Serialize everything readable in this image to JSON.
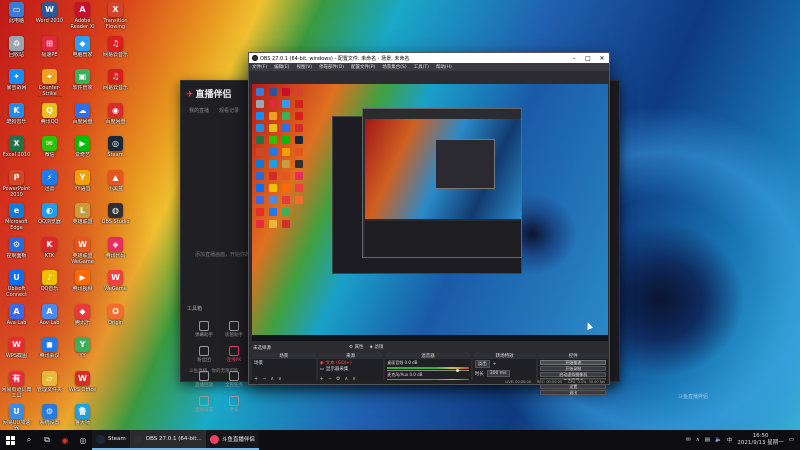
{
  "desktop": {
    "icons": [
      {
        "label": "此电脑",
        "icon": "computer-icon",
        "color": "#3a7bd5",
        "glyph": "▭"
      },
      {
        "label": "Word 2010",
        "icon": "word-icon",
        "color": "#2b579a",
        "glyph": "W"
      },
      {
        "label": "Adobe Reader XI",
        "icon": "adobe-reader-icon",
        "color": "#c8102e",
        "glyph": "A"
      },
      {
        "label": "Transition Flowing",
        "icon": "transition-icon",
        "color": "#d4412c",
        "glyph": "X"
      },
      {
        "label": "回收站",
        "icon": "recycle-bin-icon",
        "color": "#9aa6b2",
        "glyph": "♻"
      },
      {
        "label": "极速PE",
        "icon": "app-icon",
        "color": "#e0283c",
        "glyph": "⊞"
      },
      {
        "label": "电脑管家",
        "icon": "pc-manager-icon",
        "color": "#2a9df4",
        "glyph": "◆"
      },
      {
        "label": "网易云音乐",
        "icon": "music-icon",
        "color": "#d81e1e",
        "glyph": "♫"
      },
      {
        "label": "暴雪战网",
        "icon": "battlenet-icon",
        "color": "#148eff",
        "glyph": "✦"
      },
      {
        "label": "Counter-Strike Global Off",
        "icon": "csgo-icon",
        "color": "#f0a020",
        "glyph": "⌖"
      },
      {
        "label": "软件管家",
        "icon": "software-manager-icon",
        "color": "#3ab05a",
        "glyph": "▣"
      },
      {
        "label": "网易云音乐",
        "icon": "music-icon",
        "color": "#d81e1e",
        "glyph": "♫"
      },
      {
        "label": "酷狗音乐",
        "icon": "kugou-icon",
        "color": "#1e8ee8",
        "glyph": "K"
      },
      {
        "label": "腾讯QQ",
        "icon": "qq-icon",
        "color": "#e8c01e",
        "glyph": "Q"
      },
      {
        "label": "百度网盘",
        "icon": "baidu-netdisk-icon",
        "color": "#2f6fe8",
        "glyph": "☁"
      },
      {
        "label": "百度网盘",
        "icon": "app-icon",
        "color": "#d82c2c",
        "glyph": "◉"
      },
      {
        "label": "Excel 2010",
        "icon": "excel-icon",
        "color": "#217346",
        "glyph": "X"
      },
      {
        "label": "微信",
        "icon": "wechat-icon",
        "color": "#2dc100",
        "glyph": "✉"
      },
      {
        "label": "爱奇艺",
        "icon": "iqiyi-icon",
        "color": "#00be06",
        "glyph": "▶"
      },
      {
        "label": "Steam",
        "icon": "steam-icon",
        "color": "#1b2838",
        "glyph": "◎"
      },
      {
        "label": "PowerPoint 2010",
        "icon": "powerpoint-icon",
        "color": "#d24726",
        "glyph": "P"
      },
      {
        "label": "迅雷",
        "icon": "thunder-icon",
        "color": "#1e7be8",
        "glyph": "⚡"
      },
      {
        "label": "YY语音",
        "icon": "yy-icon",
        "color": "#f0a000",
        "glyph": "Y"
      },
      {
        "label": "小黑盒",
        "icon": "app-icon",
        "color": "#e8541e",
        "glyph": "▲"
      },
      {
        "label": "Microsoft Edge",
        "icon": "edge-icon",
        "color": "#0f7bd8",
        "glyph": "e"
      },
      {
        "label": "QQ浏览器",
        "icon": "qq-browser-icon",
        "color": "#1ea0e8",
        "glyph": "◐"
      },
      {
        "label": "英雄联盟",
        "icon": "lol-icon",
        "color": "#c89b3c",
        "glyph": "L"
      },
      {
        "label": "OBS Studio",
        "icon": "obs-icon",
        "color": "#302e31",
        "glyph": "◍"
      },
      {
        "label": "控制面板",
        "icon": "control-panel-icon",
        "color": "#2a6ad8",
        "glyph": "⚙"
      },
      {
        "label": "KTK",
        "icon": "app-icon",
        "color": "#d8282c",
        "glyph": "K"
      },
      {
        "label": "英雄联盟 WeGame",
        "icon": "wegame-icon",
        "color": "#e8541e",
        "glyph": "W"
      },
      {
        "label": "腾讯代码",
        "icon": "app-icon",
        "color": "#e82c5c",
        "glyph": "◈"
      },
      {
        "label": "Ubisoft Connect",
        "icon": "ubisoft-icon",
        "color": "#0070ff",
        "glyph": "U"
      },
      {
        "label": "QQ音乐",
        "icon": "qq-music-icon",
        "color": "#f0c000",
        "glyph": "♪"
      },
      {
        "label": "腾讯视频",
        "icon": "tencent-video-icon",
        "color": "#ff6a00",
        "glyph": "▶"
      },
      {
        "label": "WeGame",
        "icon": "wegame-icon",
        "color": "#f04040",
        "glyph": "W"
      },
      {
        "label": "Ava Lab",
        "icon": "app-icon",
        "color": "#3a6ae8",
        "glyph": "A"
      },
      {
        "label": "Aov Lab",
        "icon": "app-icon",
        "color": "#4a8ae8",
        "glyph": "A"
      },
      {
        "label": "腾讯乐",
        "icon": "app-icon",
        "color": "#e83a3a",
        "glyph": "◆"
      },
      {
        "label": "Origin",
        "icon": "origin-icon",
        "color": "#f56c2d",
        "glyph": "O"
      },
      {
        "label": "WPS截图",
        "icon": "wps-icon",
        "color": "#e82c2c",
        "glyph": "W"
      },
      {
        "label": "腾讯会议",
        "icon": "meeting-icon",
        "color": "#1e7be8",
        "glyph": "◼"
      },
      {
        "label": "YY",
        "icon": "app-icon",
        "color": "#3ab05a",
        "glyph": "Y"
      },
      {
        "label": "",
        "icon": "empty",
        "color": "transparent",
        "glyph": ""
      },
      {
        "label": "网易有道词典 工具",
        "icon": "youdao-icon",
        "color": "#e82c3c",
        "glyph": "有"
      },
      {
        "label": "管理文件夹",
        "icon": "folder-icon",
        "color": "#e8b83a",
        "glyph": "▱"
      },
      {
        "label": "WPS Office",
        "icon": "wps-office-icon",
        "color": "#d82c2c",
        "glyph": "W"
      },
      {
        "label": "",
        "icon": "empty",
        "color": "transparent",
        "glyph": ""
      },
      {
        "label": "网易UU加速器",
        "icon": "uu-icon",
        "color": "#3a8ae8",
        "glyph": "U"
      },
      {
        "label": "系统设置",
        "icon": "settings-icon",
        "color": "#2a7ad8",
        "glyph": "⚙"
      },
      {
        "label": "鲁大师",
        "icon": "ludashi-icon",
        "color": "#1ea0e8",
        "glyph": "鲁"
      }
    ]
  },
  "bg_app": {
    "title": "直播伴侣",
    "tabs": [
      "我的直播",
      "观看记录"
    ],
    "hint": "添加直播画面，开始你的直播",
    "toolbox_label": "工具箱",
    "tools": [
      {
        "label": "弹幕助手",
        "icon": "danmu-icon",
        "active": false
      },
      {
        "label": "房管助手",
        "icon": "admin-icon",
        "active": false
      },
      {
        "label": "粉丝团",
        "icon": "fans-icon",
        "active": false
      },
      {
        "label": "连线PK",
        "icon": "pk-icon",
        "active": true
      },
      {
        "label": "直播回放",
        "icon": "replay-icon",
        "active": false
      },
      {
        "label": "全民任务",
        "icon": "task-icon",
        "active": false
      },
      {
        "label": "直播设置",
        "icon": "settings-icon",
        "active": false
      },
      {
        "label": "更多",
        "icon": "more-icon",
        "active": false
      }
    ],
    "footer": "斗鱼直播，你的无限可能"
  },
  "obs": {
    "title": "OBS 27.0.1 (64-bit, windows) - 配置文件: 未命名 - 场景: 未命名",
    "menu": [
      "文件(F)",
      "编辑(E)",
      "视图(V)",
      "停靠部件(D)",
      "配置文件(P)",
      "场景集合(S)",
      "工具(T)",
      "帮助(H)"
    ],
    "scene_label": "未选择源",
    "mini_buttons": [
      "属性",
      "滤镜"
    ],
    "docks": {
      "scenes": {
        "title": "场景",
        "items": [
          "场景"
        ]
      },
      "sources": {
        "title": "来源",
        "items": [
          {
            "name": "文本 (GDI+)",
            "selected": true
          },
          {
            "name": "显示器采集",
            "selected": false
          }
        ]
      },
      "mixer": {
        "title": "混音器",
        "channels": [
          {
            "name": "桌面音频",
            "db": "0.0 dB"
          },
          {
            "name": "麦克风/Aux",
            "db": "0.0 dB"
          }
        ]
      },
      "transitions": {
        "title": "转场特效",
        "type": "淡出",
        "duration_label": "时长",
        "duration": "300 ms"
      },
      "controls": {
        "title": "控件",
        "buttons": [
          "开始推流",
          "开始录制",
          "启动虚拟摄像机",
          "工作室模式",
          "设置",
          "退出"
        ]
      }
    },
    "status": [
      "LIVE: 00:00:00",
      "REC: 00:00:00",
      "CPU: 0.4%, 30.00 fps"
    ]
  },
  "taskbar": {
    "apps": [
      {
        "label": "Steam",
        "icon": "steam-icon",
        "color": "#1b2838",
        "active": false
      },
      {
        "label": "OBS 27.0.1 (64-bit...",
        "icon": "obs-icon",
        "color": "#302e31",
        "active": true
      },
      {
        "label": "斗鱼直播伴侣",
        "icon": "douyu-icon",
        "color": "#f04060",
        "active": false
      }
    ],
    "tray_lang": "中",
    "time": "16:50",
    "date": "2021/9/13 星期一"
  },
  "watermark": "斗鱼直播伴侣"
}
